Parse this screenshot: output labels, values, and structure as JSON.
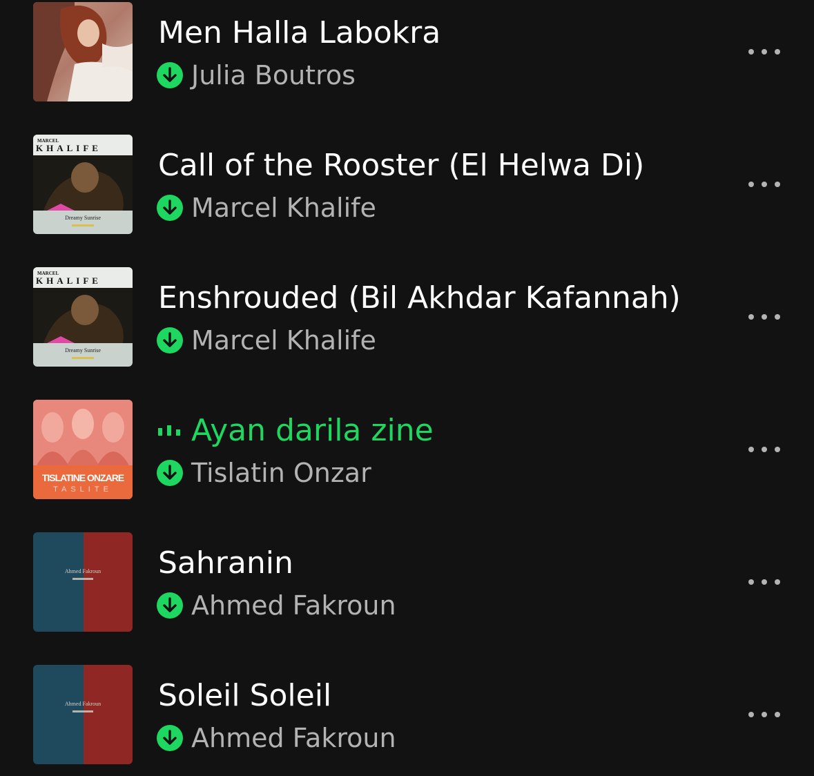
{
  "colors": {
    "background": "#121212",
    "title": "#ffffff",
    "playing": "#1ed760",
    "subtitle": "#b3b3b3",
    "download_badge": "#1ed760"
  },
  "tracks": [
    {
      "title": "Men Halla Labokra",
      "artist": "Julia Boutros",
      "downloaded": true,
      "playing": false,
      "cover": "julia-boutros-cover"
    },
    {
      "title": "Call of the Rooster (El Helwa Di)",
      "artist": "Marcel Khalife",
      "downloaded": true,
      "playing": false,
      "cover": "marcel-khalife-dreamy-sunrise-cover",
      "cover_text": {
        "name": "KHALIFE",
        "small": "MARCEL",
        "album": "Dreamy Sunrise"
      }
    },
    {
      "title": "Enshrouded (Bil Akhdar Kafannah)",
      "artist": "Marcel Khalife",
      "downloaded": true,
      "playing": false,
      "cover": "marcel-khalife-dreamy-sunrise-cover",
      "cover_text": {
        "name": "KHALIFE",
        "small": "MARCEL",
        "album": "Dreamy Sunrise"
      }
    },
    {
      "title": "Ayan darila zine",
      "artist": "Tislatin Onzar",
      "downloaded": true,
      "playing": true,
      "cover": "tislatine-onzare-cover",
      "cover_text": {
        "name": "TISLATINE ONZARE",
        "album": "TASLITE"
      }
    },
    {
      "title": "Sahranin",
      "artist": "Ahmed Fakroun",
      "downloaded": true,
      "playing": false,
      "cover": "ahmed-fakroun-cover",
      "cover_text": {
        "name": "Ahmed Fakroun"
      }
    },
    {
      "title": "Soleil Soleil",
      "artist": "Ahmed Fakroun",
      "downloaded": true,
      "playing": false,
      "cover": "ahmed-fakroun-cover",
      "cover_text": {
        "name": "Ahmed Fakroun"
      }
    }
  ]
}
